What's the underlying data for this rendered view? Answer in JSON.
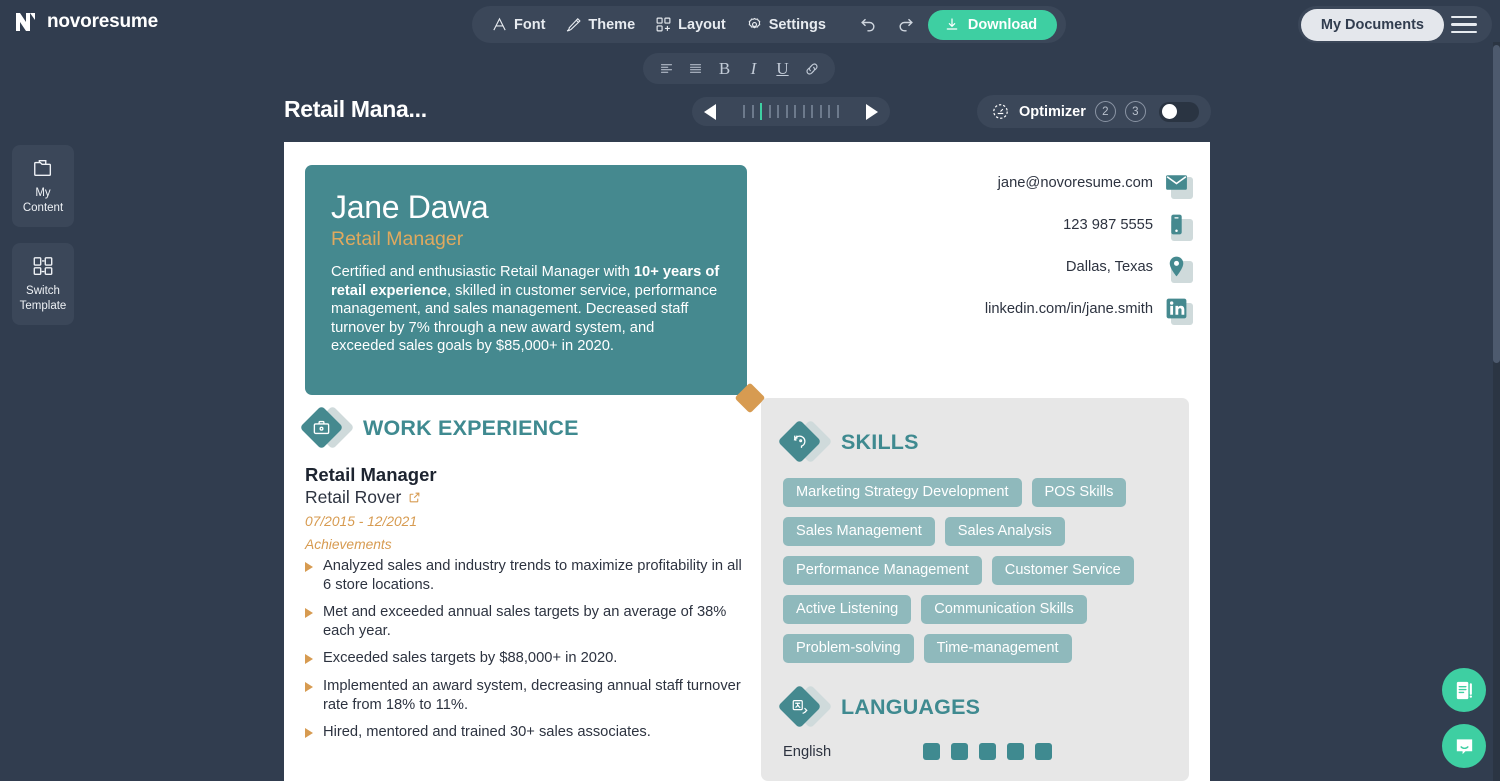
{
  "brand": {
    "name": "novoresume",
    "logo_icon": "novoresume-logo-icon"
  },
  "toolbar": {
    "font_label": "Font",
    "theme_label": "Theme",
    "layout_label": "Layout",
    "settings_label": "Settings",
    "undo_icon": "undo-icon",
    "redo_icon": "redo-icon",
    "download_label": "Download",
    "download_color": "#3ecfa2"
  },
  "format_bar": {
    "align_left": "align-left-icon",
    "align_justify": "align-justify-icon",
    "bold": "B",
    "italic": "I",
    "underline": "U",
    "link": "link-icon"
  },
  "header_right": {
    "my_documents_label": "My Documents",
    "menu_icon": "hamburger-menu-icon"
  },
  "sidebar": {
    "items": [
      {
        "label": "My\nContent",
        "line1": "My",
        "line2": "Content",
        "icon": "folder-content-icon"
      },
      {
        "label": "Switch\nTemplate",
        "line1": "Switch",
        "line2": "Template",
        "icon": "switch-template-icon"
      }
    ]
  },
  "document": {
    "title": "Retail Mana...",
    "pager": {
      "prev_icon": "arrow-left-icon",
      "next_icon": "arrow-right-icon",
      "total_ticks": 15,
      "active_tick_index": 3
    }
  },
  "optimizer": {
    "label": "Optimizer",
    "icon": "gauge-icon",
    "badges": [
      "2",
      "3"
    ],
    "toggle_on": false
  },
  "resume": {
    "hero": {
      "name": "Jane Dawa",
      "role": "Retail Manager",
      "summary_part1": "Certified and enthusiastic Retail Manager with ",
      "summary_bold": "10+ years of retail experience",
      "summary_part2": ", skilled in customer service, performance management, and sales management. Decreased staff turnover by 7% through a new award system, and exceeded sales goals by $85,000+ in 2020.",
      "bg_color": "#45898f",
      "role_color": "#e0a95e"
    },
    "contacts": [
      {
        "text": "jane@novoresume.com",
        "icon": "email-icon"
      },
      {
        "text": "123 987 5555",
        "icon": "phone-icon"
      },
      {
        "text": "Dallas, Texas",
        "icon": "location-pin-icon"
      },
      {
        "text": "linkedin.com/in/jane.smith",
        "icon": "linkedin-icon"
      }
    ],
    "work_experience": {
      "section_title": "WORK EXPERIENCE",
      "section_icon": "briefcase-icon",
      "job_title": "Retail Manager",
      "company": "Retail Rover",
      "company_link_icon": "external-link-icon",
      "dates": "07/2015 - 12/2021",
      "achievements_label": "Achievements",
      "bullets": [
        "Analyzed sales and industry trends to maximize profitability in all 6 store locations.",
        "Met and exceeded annual sales targets by an average of 38% each year.",
        "Exceeded sales targets by $88,000+ in 2020.",
        "Implemented an award system, decreasing annual staff turnover rate from 18% to 11%.",
        "Hired, mentored and trained 30+ sales associates."
      ]
    },
    "skills": {
      "section_title": "SKILLS",
      "section_icon": "skills-head-icon",
      "tags": [
        "Marketing Strategy Development",
        "POS Skills",
        "Sales Management",
        "Sales Analysis",
        "Performance Management",
        "Customer Service",
        "Active Listening",
        "Communication Skills",
        "Problem-solving",
        "Time-management"
      ]
    },
    "languages": {
      "section_title": "LANGUAGES",
      "section_icon": "translate-icon",
      "entries": [
        {
          "name": "English",
          "level": 5,
          "max": 5
        }
      ]
    }
  },
  "floating_actions": [
    {
      "icon": "document-edit-icon",
      "color": "#3ecfa2"
    },
    {
      "icon": "chat-bubble-icon",
      "color": "#3ecfa2"
    }
  ]
}
